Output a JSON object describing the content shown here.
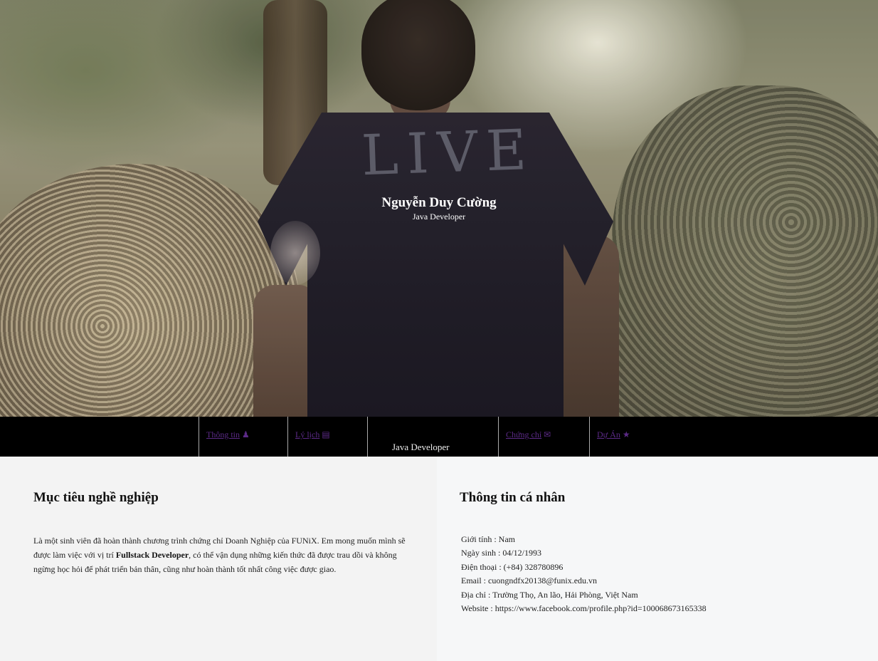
{
  "hero": {
    "name": "Nguyễn Duy Cường",
    "role": "Java Developer",
    "shirt_print": "LIVE"
  },
  "nav": {
    "items": [
      {
        "label": "Thông tin",
        "icon": "user-icon",
        "glyph": "♟"
      },
      {
        "label": "Lý lịch",
        "icon": "file-icon",
        "glyph": "▤"
      },
      {
        "label": "Chứng chỉ",
        "icon": "envelope-icon",
        "glyph": "✉"
      },
      {
        "label": "Dự Án",
        "icon": "star-icon",
        "glyph": "★"
      }
    ],
    "center_label": "Java Developer",
    "link_color": "#5b2a86"
  },
  "career": {
    "title": "Mục tiêu nghề nghiệp",
    "text_before": "Là một sinh viên đã hoàn thành chương trình chứng chỉ Doanh Nghiệp của FUNiX. Em mong muốn mình sẽ được làm việc với vị trí ",
    "text_bold": "Fullstack Developer",
    "text_after": ", có thể vận dụng những kiến thức đã được trau dồi và không ngừng học hỏi để phát triển bản thân, cũng như hoàn thành tốt nhất công việc được giao."
  },
  "personal": {
    "title": "Thông tin cá nhân",
    "lines": [
      "Giới tính : Nam",
      "Ngày sinh : 04/12/1993",
      "Điện thoại : (+84) 328780896",
      "Email : cuongndfx20138@funix.edu.vn",
      "Địa chỉ : Trường Thọ, An lão, Hải Phòng, Việt Nam",
      "Website : https://www.facebook.com/profile.php?id=100068673165338"
    ]
  }
}
